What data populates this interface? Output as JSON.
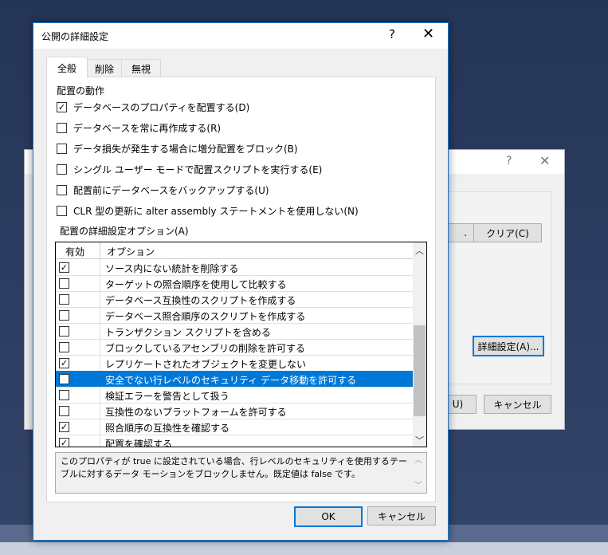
{
  "background_dialog": {
    "help_glyph": "?",
    "close_glyph": "✕",
    "partial_button_label": ".",
    "clear_button_label": "クリア(C)",
    "advanced_button_label": "詳細設定(A)...",
    "partial_u_label": "U)",
    "cancel_button_label": "キャンセル"
  },
  "dialog": {
    "title": "公開の詳細設定",
    "help_glyph": "?",
    "close_glyph": "✕",
    "tabs": [
      {
        "label": "全般",
        "active": true
      },
      {
        "label": "削除",
        "active": false
      },
      {
        "label": "無視",
        "active": false
      }
    ],
    "deployment_behavior_label": "配置の動作",
    "checkboxes": [
      {
        "label": "データベースのプロパティを配置する(D)",
        "checked": true
      },
      {
        "label": "データベースを常に再作成する(R)",
        "checked": false
      },
      {
        "label": "データ損失が発生する場合に増分配置をブロック(B)",
        "checked": false
      },
      {
        "label": "シングル ユーザー モードで配置スクリプトを実行する(E)",
        "checked": false
      },
      {
        "label": "配置前にデータベースをバックアップする(U)",
        "checked": false
      },
      {
        "label": "CLR 型の更新に alter assembly ステートメントを使用しない(N)",
        "checked": false
      }
    ],
    "advanced_options_label": "配置の詳細設定オプション(A)",
    "grid": {
      "columns": [
        "有効",
        "オプション"
      ],
      "rows": [
        {
          "label": "ソース内にない統計を削除する",
          "checked": true,
          "selected": false
        },
        {
          "label": "ターゲットの照合順序を使用して比較する",
          "checked": false,
          "selected": false
        },
        {
          "label": "データベース互換性のスクリプトを作成する",
          "checked": false,
          "selected": false
        },
        {
          "label": "データベース照合順序のスクリプトを作成する",
          "checked": false,
          "selected": false
        },
        {
          "label": "トランザクション スクリプトを含める",
          "checked": false,
          "selected": false
        },
        {
          "label": "ブロックしているアセンブリの削除を許可する",
          "checked": false,
          "selected": false
        },
        {
          "label": "レプリケートされたオブジェクトを変更しない",
          "checked": true,
          "selected": false
        },
        {
          "label": "安全でない行レベルのセキュリティ データ移動を許可する",
          "checked": false,
          "selected": true
        },
        {
          "label": "検証エラーを警告として扱う",
          "checked": false,
          "selected": false
        },
        {
          "label": "互換性のないプラットフォームを許可する",
          "checked": false,
          "selected": false
        },
        {
          "label": "照合順序の互換性を確認する",
          "checked": true,
          "selected": false
        },
        {
          "label": "配置を確認する",
          "checked": true,
          "selected": false
        }
      ]
    },
    "description": "このプロパティが true に設定されている場合、行レベルのセキュリティを使用するテーブルに対するデータ モーションをブロックしません。既定値は false です。",
    "ok_label": "OK",
    "cancel_label": "キャンセル"
  }
}
